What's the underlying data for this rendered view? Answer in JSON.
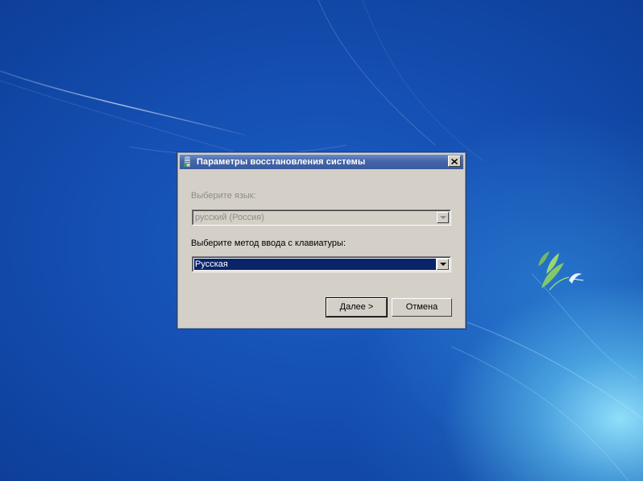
{
  "dialog": {
    "title": "Параметры восстановления системы",
    "language": {
      "label": "Выберите язык:",
      "value": "русский (Россия)",
      "enabled": false
    },
    "keyboard": {
      "label": "Выберите метод ввода с клавиатуры:",
      "value": "Русская",
      "enabled": true
    },
    "buttons": {
      "next": "Далее >",
      "cancel": "Отмена"
    },
    "icons": {
      "title": "system-recovery-icon",
      "close": "close-icon",
      "dropdown": "chevron-down-icon"
    }
  },
  "colors": {
    "dialog_face": "#d4d0c8",
    "titlebar": "#4466aa",
    "selection": "#0a246a",
    "disabled_text": "#8e8c86"
  }
}
